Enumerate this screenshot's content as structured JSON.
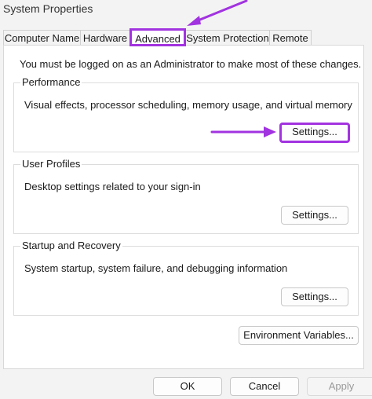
{
  "window": {
    "title": "System Properties"
  },
  "tabs": [
    {
      "label": "Computer Name",
      "active": false
    },
    {
      "label": "Hardware",
      "active": false
    },
    {
      "label": "Advanced",
      "active": true
    },
    {
      "label": "System Protection",
      "active": false
    },
    {
      "label": "Remote",
      "active": false
    }
  ],
  "advanced": {
    "intro": "You must be logged on as an Administrator to make most of these changes.",
    "performance": {
      "title": "Performance",
      "description": "Visual effects, processor scheduling, memory usage, and virtual memory",
      "button": "Settings..."
    },
    "user_profiles": {
      "title": "User Profiles",
      "description": "Desktop settings related to your sign-in",
      "button": "Settings..."
    },
    "startup_recovery": {
      "title": "Startup and Recovery",
      "description": "System startup, system failure, and debugging information",
      "button": "Settings..."
    },
    "env_button": "Environment Variables..."
  },
  "footer": {
    "ok": "OK",
    "cancel": "Cancel",
    "apply": "Apply"
  },
  "colors": {
    "annotation": "#a233e0"
  }
}
